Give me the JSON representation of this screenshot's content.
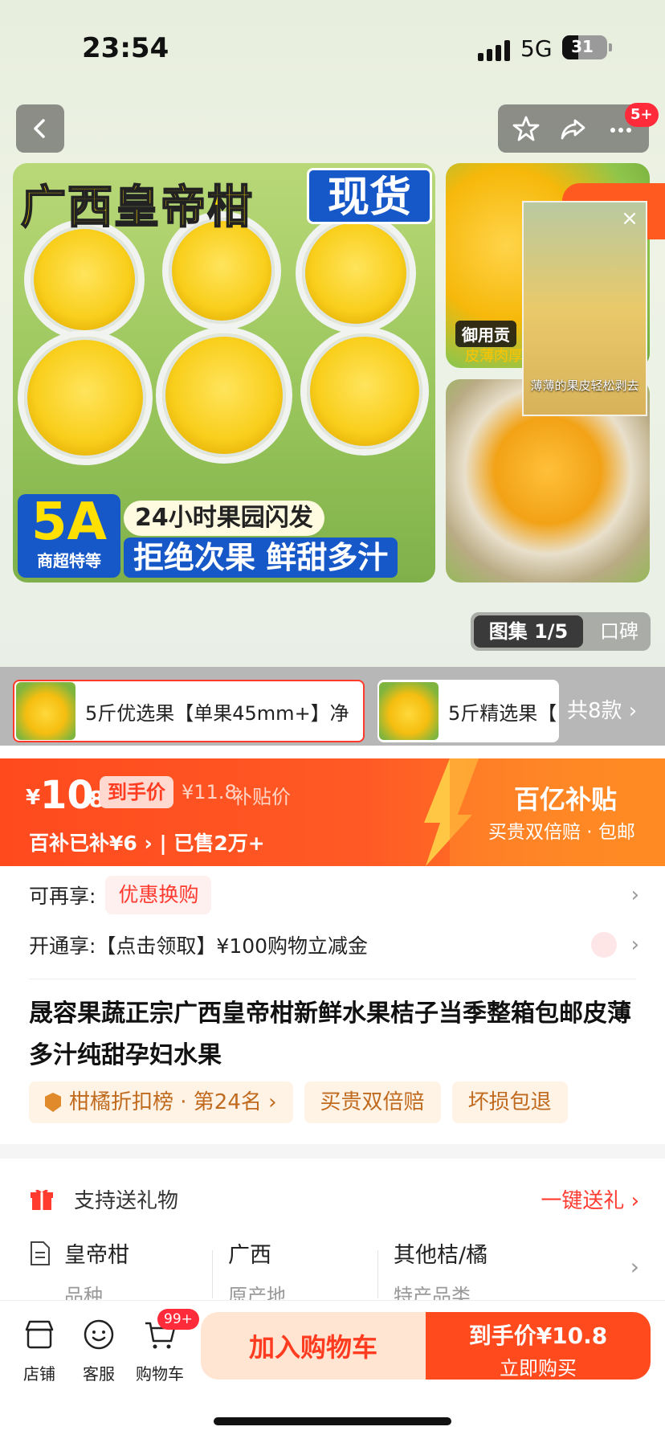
{
  "status": {
    "time": "23:54",
    "network": "5G",
    "battery": "31"
  },
  "topbar": {
    "badge": "5+"
  },
  "hero": {
    "title": "广西皇帝柑",
    "tag": "现货",
    "grade_big": "5A",
    "grade_small": "商超特等",
    "line1": "24小时果园闪发",
    "line2": "拒绝次果 鲜甜多汁"
  },
  "side": {
    "caption": "御用贡",
    "caption2": "皮薄肉厚"
  },
  "float_video": {
    "caption": "薄薄的果皮轻松剥去"
  },
  "album": {
    "active": "图集 1/5",
    "other": "口碑"
  },
  "sku": {
    "items": [
      "5斤优选果【单果45mm+】净",
      "5斤精选果【"
    ],
    "more": "共8款 ›"
  },
  "price": {
    "yen": "¥",
    "int": "10",
    "dec": ".8",
    "to_hand": "到手价",
    "orig": "¥11.8",
    "orig_label": "补贴价",
    "bai_line": "百补已补¥6 ›  |  已售2万+",
    "brand": "百亿补贴",
    "brand_sub": "买贵双倍赔 · 包邮"
  },
  "rows": {
    "enjoy_label": "可再享:",
    "enjoy_pill": "优惠换购",
    "open_label": "开通享:【点击领取】¥100购物立减金"
  },
  "product": {
    "title": "晟容果蔬正宗广西皇帝柑新鲜水果桔子当季整箱包邮皮薄多汁纯甜孕妇水果",
    "tags": [
      "柑橘折扣榜 · 第24名 ›",
      "买贵双倍赔",
      "坏损包退"
    ]
  },
  "gift": {
    "label": "支持送礼物",
    "action": "一键送礼 ›"
  },
  "specs": [
    {
      "value": "皇帝柑",
      "key": "品种"
    },
    {
      "value": "广西",
      "key": "原产地"
    },
    {
      "value": "其他桔/橘",
      "key": "特产品类"
    }
  ],
  "bottom": {
    "tabs": [
      "店铺",
      "客服",
      "购物车"
    ],
    "cart_badge": "99+",
    "add_cart": "加入购物车",
    "buy_l1": "到手价¥10.8",
    "buy_l2": "立即购买"
  }
}
